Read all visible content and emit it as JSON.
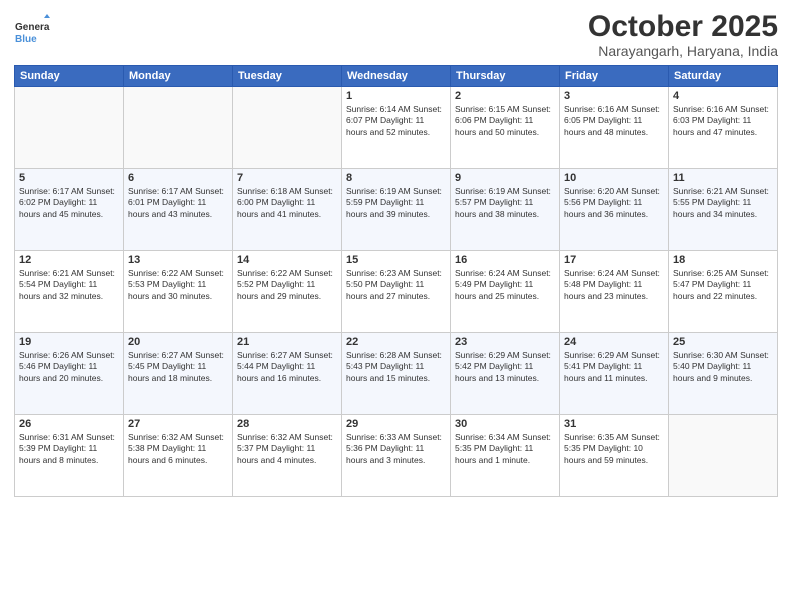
{
  "header": {
    "title": "October 2025",
    "location": "Narayangarh, Haryana, India"
  },
  "weekdays": [
    "Sunday",
    "Monday",
    "Tuesday",
    "Wednesday",
    "Thursday",
    "Friday",
    "Saturday"
  ],
  "weeks": [
    [
      {
        "day": "",
        "info": ""
      },
      {
        "day": "",
        "info": ""
      },
      {
        "day": "",
        "info": ""
      },
      {
        "day": "1",
        "info": "Sunrise: 6:14 AM\nSunset: 6:07 PM\nDaylight: 11 hours\nand 52 minutes."
      },
      {
        "day": "2",
        "info": "Sunrise: 6:15 AM\nSunset: 6:06 PM\nDaylight: 11 hours\nand 50 minutes."
      },
      {
        "day": "3",
        "info": "Sunrise: 6:16 AM\nSunset: 6:05 PM\nDaylight: 11 hours\nand 48 minutes."
      },
      {
        "day": "4",
        "info": "Sunrise: 6:16 AM\nSunset: 6:03 PM\nDaylight: 11 hours\nand 47 minutes."
      }
    ],
    [
      {
        "day": "5",
        "info": "Sunrise: 6:17 AM\nSunset: 6:02 PM\nDaylight: 11 hours\nand 45 minutes."
      },
      {
        "day": "6",
        "info": "Sunrise: 6:17 AM\nSunset: 6:01 PM\nDaylight: 11 hours\nand 43 minutes."
      },
      {
        "day": "7",
        "info": "Sunrise: 6:18 AM\nSunset: 6:00 PM\nDaylight: 11 hours\nand 41 minutes."
      },
      {
        "day": "8",
        "info": "Sunrise: 6:19 AM\nSunset: 5:59 PM\nDaylight: 11 hours\nand 39 minutes."
      },
      {
        "day": "9",
        "info": "Sunrise: 6:19 AM\nSunset: 5:57 PM\nDaylight: 11 hours\nand 38 minutes."
      },
      {
        "day": "10",
        "info": "Sunrise: 6:20 AM\nSunset: 5:56 PM\nDaylight: 11 hours\nand 36 minutes."
      },
      {
        "day": "11",
        "info": "Sunrise: 6:21 AM\nSunset: 5:55 PM\nDaylight: 11 hours\nand 34 minutes."
      }
    ],
    [
      {
        "day": "12",
        "info": "Sunrise: 6:21 AM\nSunset: 5:54 PM\nDaylight: 11 hours\nand 32 minutes."
      },
      {
        "day": "13",
        "info": "Sunrise: 6:22 AM\nSunset: 5:53 PM\nDaylight: 11 hours\nand 30 minutes."
      },
      {
        "day": "14",
        "info": "Sunrise: 6:22 AM\nSunset: 5:52 PM\nDaylight: 11 hours\nand 29 minutes."
      },
      {
        "day": "15",
        "info": "Sunrise: 6:23 AM\nSunset: 5:50 PM\nDaylight: 11 hours\nand 27 minutes."
      },
      {
        "day": "16",
        "info": "Sunrise: 6:24 AM\nSunset: 5:49 PM\nDaylight: 11 hours\nand 25 minutes."
      },
      {
        "day": "17",
        "info": "Sunrise: 6:24 AM\nSunset: 5:48 PM\nDaylight: 11 hours\nand 23 minutes."
      },
      {
        "day": "18",
        "info": "Sunrise: 6:25 AM\nSunset: 5:47 PM\nDaylight: 11 hours\nand 22 minutes."
      }
    ],
    [
      {
        "day": "19",
        "info": "Sunrise: 6:26 AM\nSunset: 5:46 PM\nDaylight: 11 hours\nand 20 minutes."
      },
      {
        "day": "20",
        "info": "Sunrise: 6:27 AM\nSunset: 5:45 PM\nDaylight: 11 hours\nand 18 minutes."
      },
      {
        "day": "21",
        "info": "Sunrise: 6:27 AM\nSunset: 5:44 PM\nDaylight: 11 hours\nand 16 minutes."
      },
      {
        "day": "22",
        "info": "Sunrise: 6:28 AM\nSunset: 5:43 PM\nDaylight: 11 hours\nand 15 minutes."
      },
      {
        "day": "23",
        "info": "Sunrise: 6:29 AM\nSunset: 5:42 PM\nDaylight: 11 hours\nand 13 minutes."
      },
      {
        "day": "24",
        "info": "Sunrise: 6:29 AM\nSunset: 5:41 PM\nDaylight: 11 hours\nand 11 minutes."
      },
      {
        "day": "25",
        "info": "Sunrise: 6:30 AM\nSunset: 5:40 PM\nDaylight: 11 hours\nand 9 minutes."
      }
    ],
    [
      {
        "day": "26",
        "info": "Sunrise: 6:31 AM\nSunset: 5:39 PM\nDaylight: 11 hours\nand 8 minutes."
      },
      {
        "day": "27",
        "info": "Sunrise: 6:32 AM\nSunset: 5:38 PM\nDaylight: 11 hours\nand 6 minutes."
      },
      {
        "day": "28",
        "info": "Sunrise: 6:32 AM\nSunset: 5:37 PM\nDaylight: 11 hours\nand 4 minutes."
      },
      {
        "day": "29",
        "info": "Sunrise: 6:33 AM\nSunset: 5:36 PM\nDaylight: 11 hours\nand 3 minutes."
      },
      {
        "day": "30",
        "info": "Sunrise: 6:34 AM\nSunset: 5:35 PM\nDaylight: 11 hours\nand 1 minute."
      },
      {
        "day": "31",
        "info": "Sunrise: 6:35 AM\nSunset: 5:35 PM\nDaylight: 10 hours\nand 59 minutes."
      },
      {
        "day": "",
        "info": ""
      }
    ]
  ]
}
